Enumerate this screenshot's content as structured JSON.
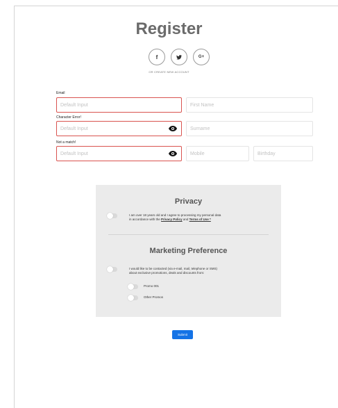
{
  "header": {
    "title": "Register",
    "or_text": "OR CREATE NEW ACCOUNT"
  },
  "socials": [
    {
      "glyph": "f",
      "icon": "facebook-icon"
    },
    {
      "glyph": "🐦",
      "icon": "twitter-icon"
    },
    {
      "glyph": "G+",
      "icon": "google-plus-icon"
    }
  ],
  "form": {
    "email": {
      "label": "Email",
      "placeholder": "Default Input",
      "state": "error"
    },
    "first_name": {
      "placeholder": "First Name"
    },
    "password": {
      "label": "Character Error!",
      "placeholder": "Default Input",
      "state": "error"
    },
    "surname": {
      "placeholder": "Surname"
    },
    "confirm": {
      "label": "Not a match!",
      "placeholder": "Default Input",
      "state": "error"
    },
    "mobile": {
      "placeholder": "Mobile"
    },
    "birthday": {
      "placeholder": "Birthday"
    }
  },
  "privacy": {
    "title": "Privacy",
    "text_line1": "I am over 18 years old and I agree to processing my personal data",
    "text_line2_prefix": "in accordance with the",
    "privacy_link": "Privacy Policy",
    "and": "and",
    "terms_link": "Terms of Use *"
  },
  "marketing": {
    "title": "Marketing Preference",
    "text_line1": "I would like to be contacted (via e-mail, mail, telephone or SMS)",
    "text_line2": "about exclusive promotions, deals and discounts from:",
    "promos": [
      "Promo 001",
      "Other Promos"
    ]
  },
  "submit_label": "Submit",
  "colors": {
    "error": "#d9534f",
    "primary": "#1473e6",
    "panel": "#ebebeb"
  }
}
